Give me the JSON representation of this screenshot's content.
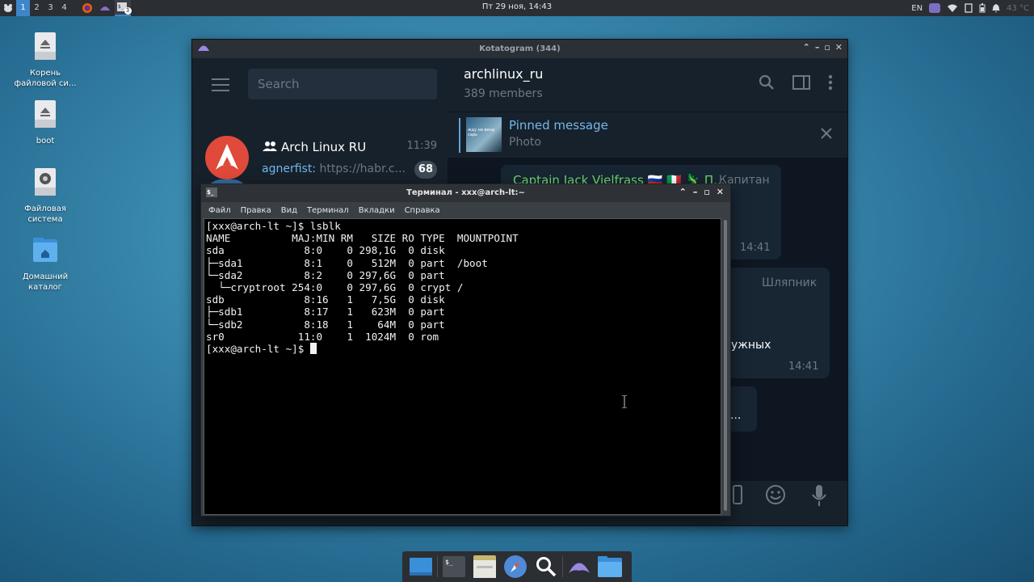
{
  "top_panel": {
    "workspaces": [
      "1",
      "2",
      "3",
      "4"
    ],
    "active_workspace": "1",
    "clock": "Пт 29 ноя, 14:43",
    "keyboard_layout": "EN",
    "temperature": "43 °C",
    "terminal_badge": "3",
    "icons": [
      "whisker-menu-icon",
      "firefox-icon",
      "kotatogram-icon",
      "terminal-icon",
      "notification-badge-icon",
      "wifi-icon",
      "clipboard-icon",
      "battery-icon",
      "bell-icon"
    ]
  },
  "desktop": {
    "icons": [
      {
        "label": "Корень\nфайловой си...",
        "icon": "drive-eject-icon"
      },
      {
        "label": "boot",
        "icon": "drive-eject-icon"
      },
      {
        "label": "Файловая\nсистема",
        "icon": "hard-disk-icon"
      },
      {
        "label": "Домашний\nкаталог",
        "icon": "home-folder-icon"
      }
    ]
  },
  "telegram": {
    "window_title": "Kotatogram (344)",
    "search_placeholder": "Search",
    "chat": {
      "name": "Arch Linux RU",
      "time": "11:39",
      "preview_from": "agnerfist:",
      "preview_text": " https://habr.c...",
      "unread": "68"
    },
    "header": {
      "title": "archlinux_ru",
      "members": "389 members"
    },
    "pinned": {
      "title": "Pinned message",
      "subtitle": "Photo",
      "thumb_text": "жду на венд\nсарь"
    },
    "messages": [
      {
        "sender": "Captain Jack Vielfrass 🇷🇺 🇮🇹 🦎 П...",
        "role": "Капитан",
        "time": "14:41"
      },
      {
        "role": "Шляпник",
        "text": "ужных",
        "time": "14:41"
      },
      {
        "text": "..."
      }
    ],
    "accent": "#72b8ec",
    "sender_color": "#6dd86a"
  },
  "terminal": {
    "title": "Терминал - xxx@arch-lt:~",
    "menu": [
      "Файл",
      "Правка",
      "Вид",
      "Терминал",
      "Вкладки",
      "Справка"
    ],
    "lines": [
      "[xxx@arch-lt ~]$ lsblk",
      "NAME          MAJ:MIN RM   SIZE RO TYPE  MOUNTPOINT",
      "sda             8:0    0 298,1G  0 disk",
      "├─sda1          8:1    0   512M  0 part  /boot",
      "└─sda2          8:2    0 297,6G  0 part",
      "  └─cryptroot 254:0    0 297,6G  0 crypt /",
      "sdb             8:16   1   7,5G  0 disk",
      "├─sdb1          8:17   1   623M  0 part",
      "└─sdb2          8:18   1    64M  0 part",
      "sr0            11:0    1  1024M  0 rom"
    ],
    "prompt": "[xxx@arch-lt ~]$ "
  },
  "dock": {
    "items": [
      "show-desktop-icon",
      "terminal-icon",
      "file-manager-icon",
      "web-browser-icon",
      "app-finder-icon",
      "kotatogram-icon",
      "home-folder-icon"
    ]
  }
}
